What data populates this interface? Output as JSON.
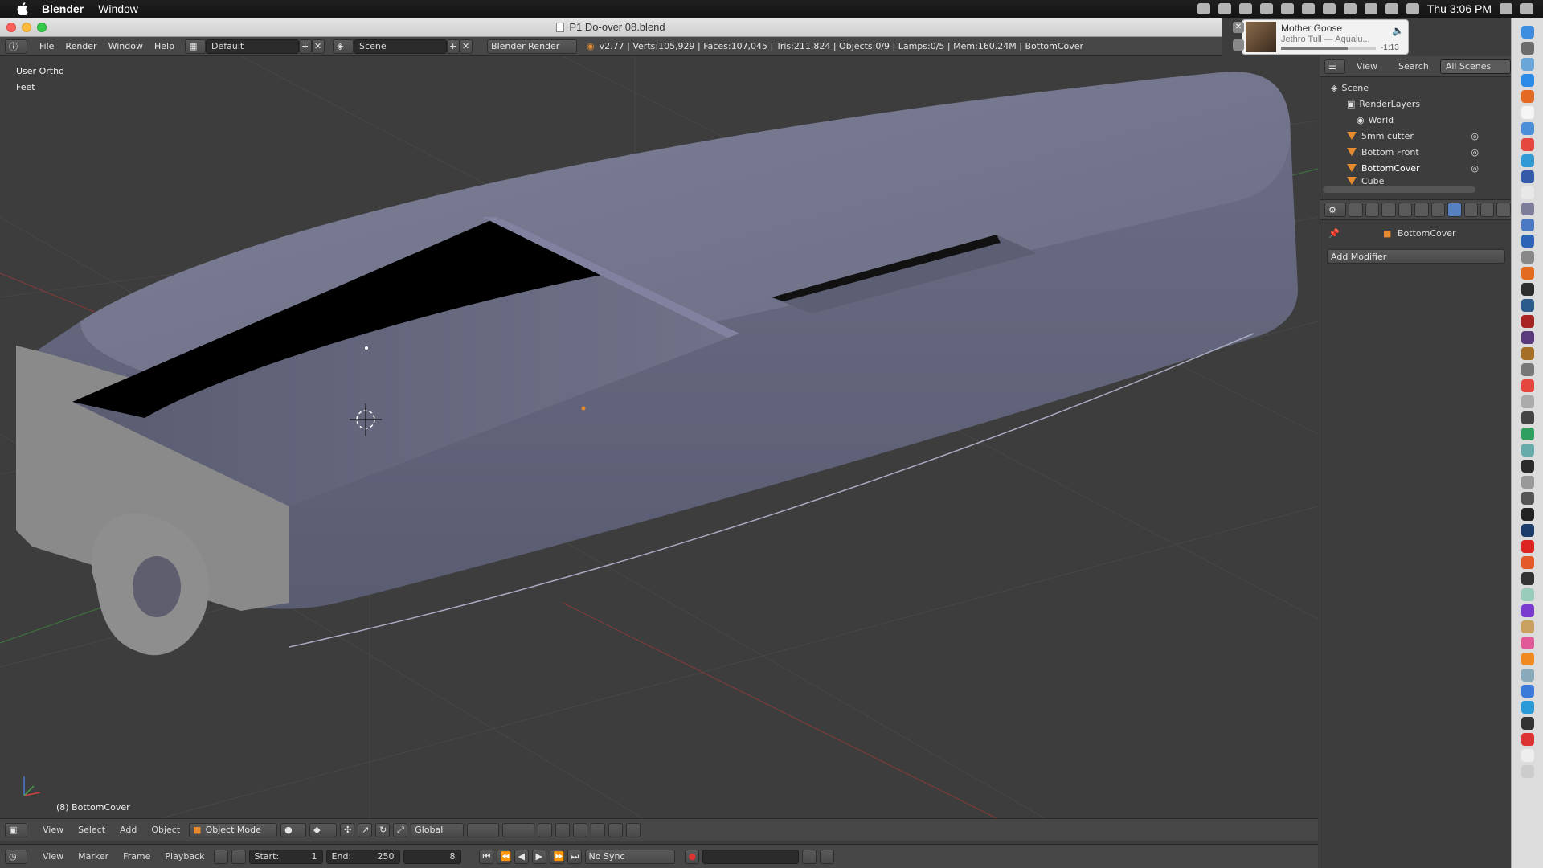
{
  "menubar": {
    "app_name": "Blender",
    "menu_window": "Window",
    "clock": "Thu 3:06 PM"
  },
  "titlebar": {
    "title": "P1 Do-over 08.blend"
  },
  "now_playing": {
    "track": "Mother Goose",
    "artist": "Jethro Tull — Aqualu...",
    "remaining": "-1:13"
  },
  "info_header": {
    "menus": [
      "File",
      "Render",
      "Window",
      "Help"
    ],
    "layout": "Default",
    "scene": "Scene",
    "engine": "Blender Render",
    "stats": "v2.77 | Verts:105,929 | Faces:107,045 | Tris:211,824 | Objects:0/9 | Lamps:0/5 | Mem:160.24M | BottomCover"
  },
  "viewport": {
    "view_name": "User Ortho",
    "units": "Feet",
    "object_label": "(8) BottomCover"
  },
  "outliner": {
    "tabs": [
      "View",
      "Search",
      "All Scenes"
    ],
    "items": [
      {
        "label": "Scene"
      },
      {
        "label": "RenderLayers"
      },
      {
        "label": "World"
      },
      {
        "label": "5mm cutter"
      },
      {
        "label": "Bottom Front"
      },
      {
        "label": "BottomCover"
      },
      {
        "label": "Cube"
      }
    ]
  },
  "properties": {
    "object_name": "BottomCover",
    "add_modifier": "Add Modifier"
  },
  "view3d_header": {
    "menus": [
      "View",
      "Select",
      "Add",
      "Object"
    ],
    "mode": "Object Mode",
    "orientation": "Global"
  },
  "timeline_header": {
    "menus": [
      "View",
      "Marker",
      "Frame",
      "Playback"
    ],
    "start": "Start:",
    "start_value": "1",
    "end": "End:",
    "end_value": "250",
    "current_frame": "8",
    "sync": "No Sync"
  }
}
